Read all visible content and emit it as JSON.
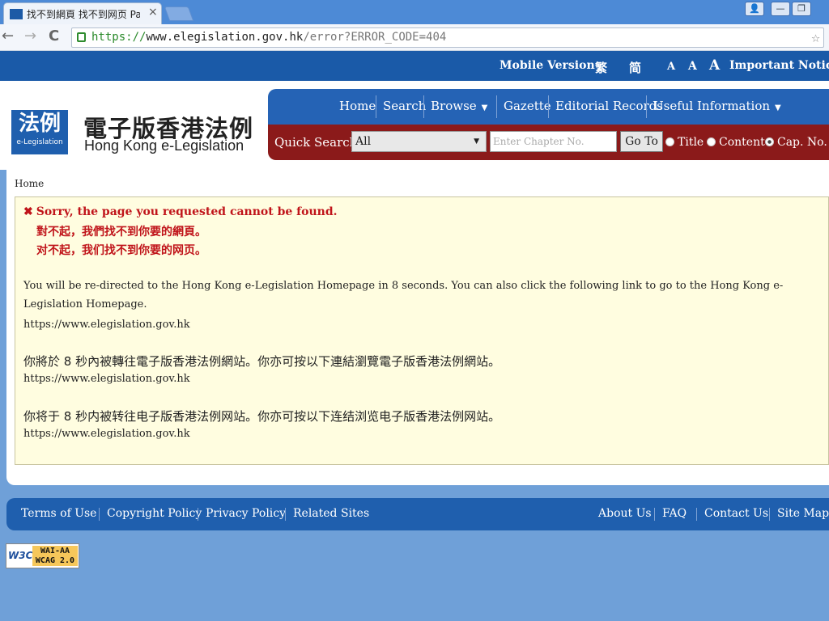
{
  "browser": {
    "tab_title": "找不到網頁 找不到网页 Pa",
    "tab_close": "×",
    "back": "←",
    "forward": "→",
    "reload": "C",
    "url_scheme": "https://",
    "url_host": "www.elegislation.gov.hk",
    "url_path": "/error?ERROR_CODE=404",
    "star": "☆",
    "window_controls": [
      "👤",
      "—",
      "❐"
    ]
  },
  "topbar": {
    "mobile": "Mobile Version",
    "trad": "繁",
    "simp": "简",
    "font_small": "A",
    "font_medium": "A",
    "font_large": "A",
    "notices": "Important Notices"
  },
  "logo": {
    "badge_cn": "法例",
    "badge_en": "e-Legislation",
    "site_cn": "電子版香港法例",
    "site_en": "Hong Kong e-Legislation"
  },
  "nav": {
    "items": [
      "Home",
      "Search",
      "Browse",
      "Gazette",
      "Editorial Records",
      "Useful Information"
    ]
  },
  "quick_search": {
    "label": "Quick Search",
    "select_value": "All",
    "placeholder": "Enter Chapter No.",
    "go": "Go To",
    "radios": [
      "Title",
      "Content",
      "Cap. No."
    ],
    "selected": "Cap. No."
  },
  "main": {
    "breadcrumb": "Home",
    "error_en": "Sorry, the page you requested cannot be found.",
    "error_tc": "對不起，我們找不到你要的網頁。",
    "error_sc": "对不起，我们找不到你要的网页。",
    "redirect_en": "You will be re-directed to the Hong Kong e-Legislation Homepage in 8 seconds. You can also click the following link to go to the Hong Kong e-Legislation Homepage.",
    "link1": "https://www.elegislation.gov.hk",
    "redirect_tc": "你將於 8 秒內被轉往電子版香港法例網站。你亦可按以下連結瀏覽電子版香港法例網站。",
    "link2": "https://www.elegislation.gov.hk",
    "redirect_sc": "你将于 8 秒内被转往电子版香港法例网站。你亦可按以下连结浏览电子版香港法例网站。",
    "link3": "https://www.elegislation.gov.hk"
  },
  "footer": {
    "left": [
      "Terms of Use",
      "Copyright Policy",
      "Privacy Policy",
      "Related Sites"
    ],
    "right": [
      "About Us",
      "FAQ",
      "Contact Us",
      "Site Map"
    ]
  },
  "badge": {
    "w3c": "W3C",
    "line1": "WAI-AA",
    "line2": "WCAG 2.0"
  },
  "colors": {
    "brand_blue": "#1f5fae",
    "quick_search_red": "#8b1a1a",
    "error_red": "#c0141a",
    "message_bg": "#fffde0"
  },
  "icons": [
    "tab-favicon-icon",
    "close-icon",
    "back-arrow-icon",
    "forward-arrow-icon",
    "reload-icon",
    "lock-icon",
    "star-icon",
    "chevron-down-icon",
    "error-x-icon",
    "radio-icon"
  ]
}
